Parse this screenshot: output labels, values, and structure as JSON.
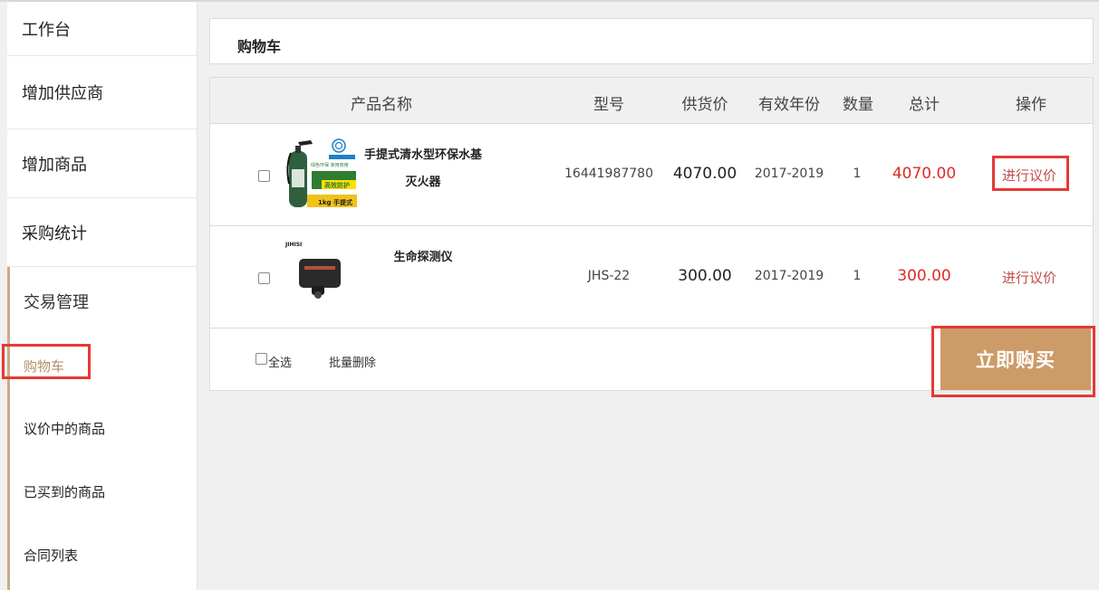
{
  "sidebar": {
    "items": [
      {
        "label": "工作台"
      },
      {
        "label": "增加供应商"
      },
      {
        "label": "增加商品"
      },
      {
        "label": "采购统计"
      }
    ],
    "group": {
      "label": "交易管理",
      "items": [
        {
          "label": "购物车"
        },
        {
          "label": "议价中的商品"
        },
        {
          "label": "已买到的商品"
        },
        {
          "label": "合同列表"
        }
      ]
    }
  },
  "main": {
    "title": "购物车",
    "columns": [
      "产品名称",
      "型号",
      "供货价",
      "有效年份",
      "数量",
      "总计",
      "操作"
    ],
    "rows": [
      {
        "name_line1": "手提式清水型环保水基",
        "name_line2": "灭火器",
        "model": "16441987780",
        "price": "4070.00",
        "years": "2017-2019",
        "qty": "1",
        "total": "4070.00",
        "action": "进行议价",
        "image_text": {
          "brand": "绿色环保 家用商用",
          "line2": "高效防护",
          "line3": "1kg 手提式"
        }
      },
      {
        "name_line1": "生命探测仪",
        "model": "JHS-22",
        "price": "300.00",
        "years": "2017-2019",
        "qty": "1",
        "total": "300.00",
        "action": "进行议价",
        "image_text": {
          "brand": "JIHISI"
        }
      }
    ],
    "footer": {
      "select_all": "全选",
      "batch_delete": "批量删除",
      "buy_now": "立即购买"
    }
  },
  "colors": {
    "accent": "#cc9b67",
    "highlight_box": "#e53935",
    "total_red": "#e02a2a",
    "sidebar_marker": "#c9ab87"
  }
}
